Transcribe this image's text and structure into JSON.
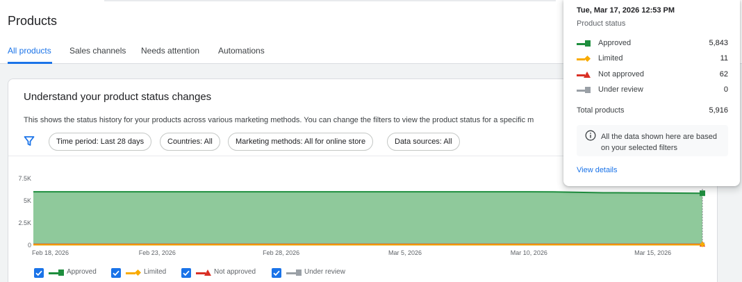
{
  "page": {
    "title": "Products"
  },
  "tabs": [
    {
      "label": "All products",
      "active": true
    },
    {
      "label": "Sales channels",
      "active": false
    },
    {
      "label": "Needs attention",
      "active": false
    },
    {
      "label": "Automations",
      "active": false
    }
  ],
  "card": {
    "title": "Understand your product status changes",
    "description": "This shows the status history for your products across various marketing methods. You can change the filters to view the product status for a specific m",
    "filter_icon": "filter-icon",
    "filters": [
      "Time period: Last 28 days",
      "Countries: All",
      "Marketing methods: All for online store",
      "Data sources: All"
    ]
  },
  "chart_data": {
    "type": "area",
    "y_ticks": [
      "7.5K",
      "5K",
      "2.5K",
      "0"
    ],
    "ylim": [
      0,
      7500
    ],
    "x_tick_labels": [
      "Feb 18, 2026",
      "Feb 23, 2026",
      "Feb 28, 2026",
      "Mar 5, 2026",
      "Mar 10, 2026",
      "Mar 15, 2026"
    ],
    "x_tick_days": [
      0,
      5,
      10,
      15,
      20,
      25
    ],
    "x": [
      "Feb 18, 2026",
      "Feb 19, 2026",
      "Feb 20, 2026",
      "Feb 21, 2026",
      "Feb 22, 2026",
      "Feb 23, 2026",
      "Feb 24, 2026",
      "Feb 25, 2026",
      "Feb 26, 2026",
      "Feb 27, 2026",
      "Feb 28, 2026",
      "Mar 1, 2026",
      "Mar 2, 2026",
      "Mar 3, 2026",
      "Mar 4, 2026",
      "Mar 5, 2026",
      "Mar 6, 2026",
      "Mar 7, 2026",
      "Mar 8, 2026",
      "Mar 9, 2026",
      "Mar 10, 2026",
      "Mar 11, 2026",
      "Mar 12, 2026",
      "Mar 13, 2026",
      "Mar 14, 2026",
      "Mar 15, 2026",
      "Mar 16, 2026",
      "Mar 17, 2026"
    ],
    "series": [
      {
        "name": "Approved",
        "color": "#1e8e3e",
        "fill": "#8fc99b",
        "marker": "square",
        "values": [
          6010,
          6010,
          6010,
          6010,
          6010,
          6010,
          6010,
          6010,
          6010,
          6010,
          6010,
          6010,
          6010,
          6010,
          6010,
          6010,
          6010,
          6010,
          6010,
          6010,
          6010,
          6000,
          5950,
          5900,
          5890,
          5880,
          5860,
          5843
        ]
      },
      {
        "name": "Limited",
        "color": "#f9ab00",
        "marker": "diamond",
        "values": [
          11,
          11,
          11,
          11,
          11,
          11,
          11,
          11,
          11,
          11,
          11,
          11,
          11,
          11,
          11,
          11,
          11,
          11,
          11,
          11,
          11,
          11,
          11,
          11,
          11,
          11,
          11,
          11
        ]
      },
      {
        "name": "Not approved",
        "color": "#d93025",
        "marker": "triangle",
        "values": [
          62,
          62,
          62,
          62,
          62,
          62,
          62,
          62,
          62,
          62,
          62,
          62,
          62,
          62,
          62,
          62,
          62,
          62,
          62,
          62,
          62,
          62,
          62,
          62,
          62,
          62,
          62,
          62
        ]
      },
      {
        "name": "Under review",
        "color": "#9aa0a6",
        "marker": "square",
        "values": [
          0,
          0,
          0,
          0,
          0,
          0,
          0,
          0,
          0,
          0,
          0,
          0,
          0,
          0,
          0,
          0,
          0,
          0,
          0,
          0,
          0,
          0,
          0,
          0,
          0,
          0,
          0,
          0
        ]
      }
    ]
  },
  "legend": [
    {
      "label": "Approved",
      "checked": true
    },
    {
      "label": "Limited",
      "checked": true
    },
    {
      "label": "Not approved",
      "checked": true
    },
    {
      "label": "Under review",
      "checked": true
    }
  ],
  "tooltip": {
    "date": "Tue, Mar 17, 2026 12:53 PM",
    "subtitle": "Product status",
    "rows": [
      {
        "label": "Approved",
        "value": "5,843"
      },
      {
        "label": "Limited",
        "value": "11"
      },
      {
        "label": "Not approved",
        "value": "62"
      },
      {
        "label": "Under review",
        "value": "0"
      }
    ],
    "total_label": "Total products",
    "total_value": "5,916",
    "info_icon": "info-icon",
    "info_text": "All the data shown here are based on your selected filters",
    "link_label": "View details"
  }
}
